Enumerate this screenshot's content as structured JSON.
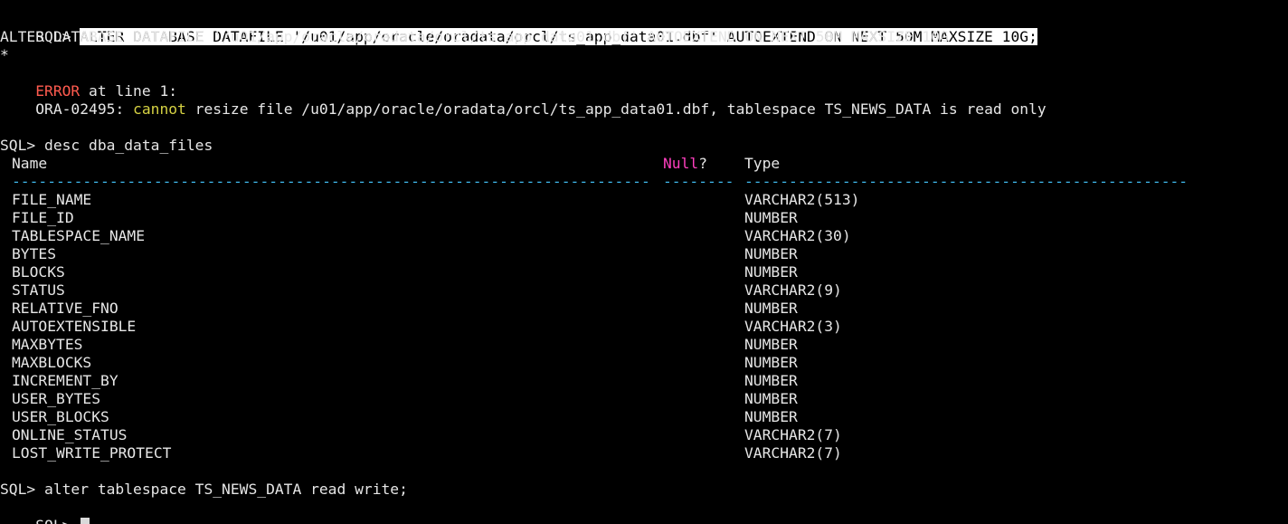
{
  "terminal": {
    "alter_cmd": {
      "prompt": "SQL> ",
      "command": "ALTER DATABASE DATAFILE '/u01/app/oracle/oradata/orcl/ts_app_data01.dbf' AUTOEXTEND ON NEXT 50M MAXSIZE 10G;"
    },
    "echo_line": "ALTER DATABASE DATAFILE '/u01/app/oracle/oradata/orcl/ts_app_data01.dbf' AUTOEXTEND ON NEXT 50M MAXSIZE 10G",
    "error_marker": "*",
    "error_header": {
      "word": "ERROR",
      "rest": " at line 1:"
    },
    "ora_error": {
      "code": "ORA-02495: ",
      "keyword": "cannot",
      "message": " resize file /u01/app/oracle/oradata/orcl/ts_app_data01.dbf, tablespace TS_NEWS_DATA is read only"
    },
    "desc_cmd": "SQL> desc dba_data_files",
    "desc_headers": {
      "name": "Name",
      "null_word": "Null",
      "null_q": "?",
      "type": "Type"
    },
    "desc_separators": {
      "name": "------------------------------------------------------------------------",
      "null": "--------",
      "type": "--------------------------------------------------"
    },
    "columns": [
      {
        "name": "FILE_NAME",
        "type": "VARCHAR2(513)"
      },
      {
        "name": "FILE_ID",
        "type": "NUMBER"
      },
      {
        "name": "TABLESPACE_NAME",
        "type": "VARCHAR2(30)"
      },
      {
        "name": "BYTES",
        "type": "NUMBER"
      },
      {
        "name": "BLOCKS",
        "type": "NUMBER"
      },
      {
        "name": "STATUS",
        "type": "VARCHAR2(9)"
      },
      {
        "name": "RELATIVE_FNO",
        "type": "NUMBER"
      },
      {
        "name": "AUTOEXTENSIBLE",
        "type": "VARCHAR2(3)"
      },
      {
        "name": "MAXBYTES",
        "type": "NUMBER"
      },
      {
        "name": "MAXBLOCKS",
        "type": "NUMBER"
      },
      {
        "name": "INCREMENT_BY",
        "type": "NUMBER"
      },
      {
        "name": "USER_BYTES",
        "type": "NUMBER"
      },
      {
        "name": "USER_BLOCKS",
        "type": "NUMBER"
      },
      {
        "name": "ONLINE_STATUS",
        "type": "VARCHAR2(7)"
      },
      {
        "name": "LOST_WRITE_PROTECT",
        "type": "VARCHAR2(7)"
      }
    ],
    "alter_tablespace_cmd": "SQL> alter tablespace TS_NEWS_DATA read write;",
    "final_prompt": "SQL> ",
    "colors": {
      "background": "#000000",
      "text": "#e6e6e6",
      "error": "#ff5b4f",
      "keyword": "#d6d243",
      "null_header": "#ff3fbf",
      "separator": "#3fb6e8",
      "selection_bg": "#ffffff",
      "cursor": "#d9d9d9"
    }
  }
}
